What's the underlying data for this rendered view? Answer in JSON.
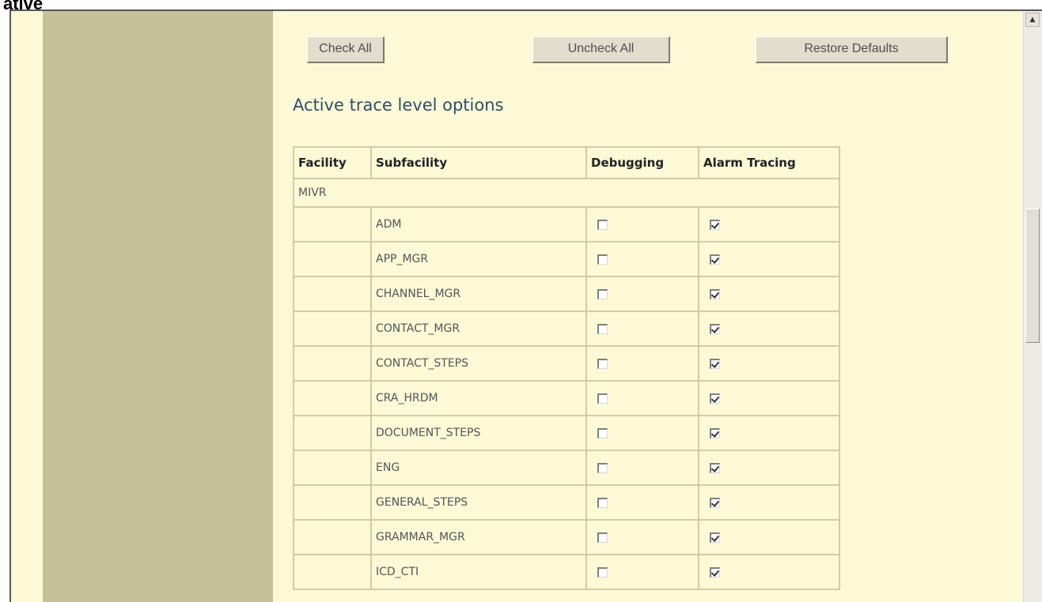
{
  "top_text": "ative",
  "buttons": {
    "check_all": "Check All",
    "uncheck_all": "Uncheck All",
    "restore_defaults": "Restore Defaults"
  },
  "heading": "Active trace level options",
  "table": {
    "headers": [
      "Facility",
      "Subfacility",
      "Debugging",
      "Alarm Tracing"
    ],
    "facility": "MIVR",
    "rows": [
      {
        "subfacility": "ADM",
        "debugging": false,
        "alarm_tracing": true
      },
      {
        "subfacility": "APP_MGR",
        "debugging": false,
        "alarm_tracing": true
      },
      {
        "subfacility": "CHANNEL_MGR",
        "debugging": false,
        "alarm_tracing": true
      },
      {
        "subfacility": "CONTACT_MGR",
        "debugging": false,
        "alarm_tracing": true
      },
      {
        "subfacility": "CONTACT_STEPS",
        "debugging": false,
        "alarm_tracing": true
      },
      {
        "subfacility": "CRA_HRDM",
        "debugging": false,
        "alarm_tracing": true
      },
      {
        "subfacility": "DOCUMENT_STEPS",
        "debugging": false,
        "alarm_tracing": true
      },
      {
        "subfacility": "ENG",
        "debugging": false,
        "alarm_tracing": true
      },
      {
        "subfacility": "GENERAL_STEPS",
        "debugging": false,
        "alarm_tracing": true
      },
      {
        "subfacility": "GRAMMAR_MGR",
        "debugging": false,
        "alarm_tracing": true
      },
      {
        "subfacility": "ICD_CTI",
        "debugging": false,
        "alarm_tracing": true
      }
    ]
  },
  "colors": {
    "content_bg": "#fbf9d6",
    "sidebar_bg": "#c6c19a",
    "heading_color": "#2f4f6b",
    "table_border": "#d0cca8"
  },
  "icons": {
    "scroll_up": "triangle-up-icon"
  }
}
